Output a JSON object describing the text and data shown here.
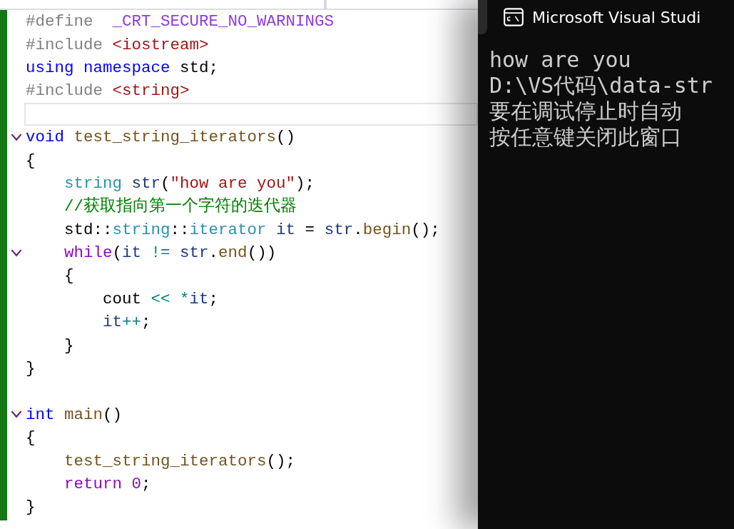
{
  "editor": {
    "lines": [
      {
        "current": false,
        "tokens": [
          {
            "text": "#define  ",
            "kind": "pp"
          },
          {
            "text": "_CRT_SECURE_NO_WARNINGS",
            "kind": "macro"
          }
        ]
      },
      {
        "current": false,
        "tokens": [
          {
            "text": "#include ",
            "kind": "pp"
          },
          {
            "text": "<iostream>",
            "kind": "include"
          }
        ]
      },
      {
        "current": false,
        "tokens": [
          {
            "text": "using namespace",
            "kind": "keyword"
          },
          {
            "text": " std;",
            "kind": "plain"
          }
        ]
      },
      {
        "current": false,
        "tokens": [
          {
            "text": "#include ",
            "kind": "pp"
          },
          {
            "text": "<string>",
            "kind": "include"
          }
        ]
      },
      {
        "current": true
      },
      {
        "current": false,
        "expanded": true,
        "tokens": [
          {
            "text": "void",
            "kind": "keyword"
          },
          {
            "text": " test_string_iterators",
            "kind": "func"
          },
          {
            "text": "()",
            "kind": "plain"
          }
        ]
      },
      {
        "current": false,
        "tokens": [
          {
            "text": "{",
            "kind": "plain"
          }
        ]
      },
      {
        "current": false,
        "tokens": [
          {
            "text": "    string",
            "kind": "type"
          },
          {
            "text": " str",
            "kind": "var"
          },
          {
            "text": "(",
            "kind": "plain"
          },
          {
            "text": "\"how are you\"",
            "kind": "string"
          },
          {
            "text": ");",
            "kind": "plain"
          }
        ]
      },
      {
        "current": false,
        "tokens": [
          {
            "text": "    //获取指向第一个字符的迭代器",
            "kind": "comment"
          }
        ]
      },
      {
        "current": false,
        "tokens": [
          {
            "text": "    std::",
            "kind": "plain"
          },
          {
            "text": "string",
            "kind": "type"
          },
          {
            "text": "::",
            "kind": "plain"
          },
          {
            "text": "iterator",
            "kind": "type"
          },
          {
            "text": " it",
            "kind": "var"
          },
          {
            "text": " = ",
            "kind": "plain"
          },
          {
            "text": "str",
            "kind": "var"
          },
          {
            "text": ".",
            "kind": "plain"
          },
          {
            "text": "begin",
            "kind": "member"
          },
          {
            "text": "();",
            "kind": "plain"
          }
        ]
      },
      {
        "current": false,
        "expanded": true,
        "tokens": [
          {
            "text": "    while",
            "kind": "ctrl"
          },
          {
            "text": "(",
            "kind": "plain"
          },
          {
            "text": "it",
            "kind": "var"
          },
          {
            "text": " != ",
            "kind": "op"
          },
          {
            "text": "str",
            "kind": "var"
          },
          {
            "text": ".",
            "kind": "plain"
          },
          {
            "text": "end",
            "kind": "member"
          },
          {
            "text": "())",
            "kind": "plain"
          }
        ]
      },
      {
        "current": false,
        "tokens": [
          {
            "text": "    {",
            "kind": "plain"
          }
        ]
      },
      {
        "current": false,
        "tokens": [
          {
            "text": "        cout",
            "kind": "plain"
          },
          {
            "text": " << *",
            "kind": "op"
          },
          {
            "text": "it",
            "kind": "var"
          },
          {
            "text": ";",
            "kind": "plain"
          }
        ]
      },
      {
        "current": false,
        "tokens": [
          {
            "text": "        it",
            "kind": "var"
          },
          {
            "text": "++",
            "kind": "op"
          },
          {
            "text": ";",
            "kind": "plain"
          }
        ]
      },
      {
        "current": false,
        "tokens": [
          {
            "text": "    }",
            "kind": "plain"
          }
        ]
      },
      {
        "current": false,
        "tokens": [
          {
            "text": "}",
            "kind": "plain"
          }
        ]
      },
      {
        "current": false
      },
      {
        "current": false,
        "expanded": true,
        "tokens": [
          {
            "text": "int",
            "kind": "keyword"
          },
          {
            "text": " main",
            "kind": "func"
          },
          {
            "text": "()",
            "kind": "plain"
          }
        ]
      },
      {
        "current": false,
        "tokens": [
          {
            "text": "{",
            "kind": "plain"
          }
        ]
      },
      {
        "current": false,
        "tokens": [
          {
            "text": "    test_string_iterators",
            "kind": "func"
          },
          {
            "text": "();",
            "kind": "plain"
          }
        ]
      },
      {
        "current": false,
        "tokens": [
          {
            "text": "    return",
            "kind": "ctrl"
          },
          {
            "text": " 0",
            "kind": "number"
          },
          {
            "text": ";",
            "kind": "plain"
          }
        ]
      },
      {
        "current": false,
        "tokens": [
          {
            "text": "}",
            "kind": "plain"
          }
        ]
      }
    ]
  },
  "console": {
    "title": "Microsoft Visual Studi",
    "lines": [
      "how are you",
      "D:\\VS代码\\data-str",
      "要在调试停止时自动",
      "按任意键关闭此窗口"
    ]
  }
}
